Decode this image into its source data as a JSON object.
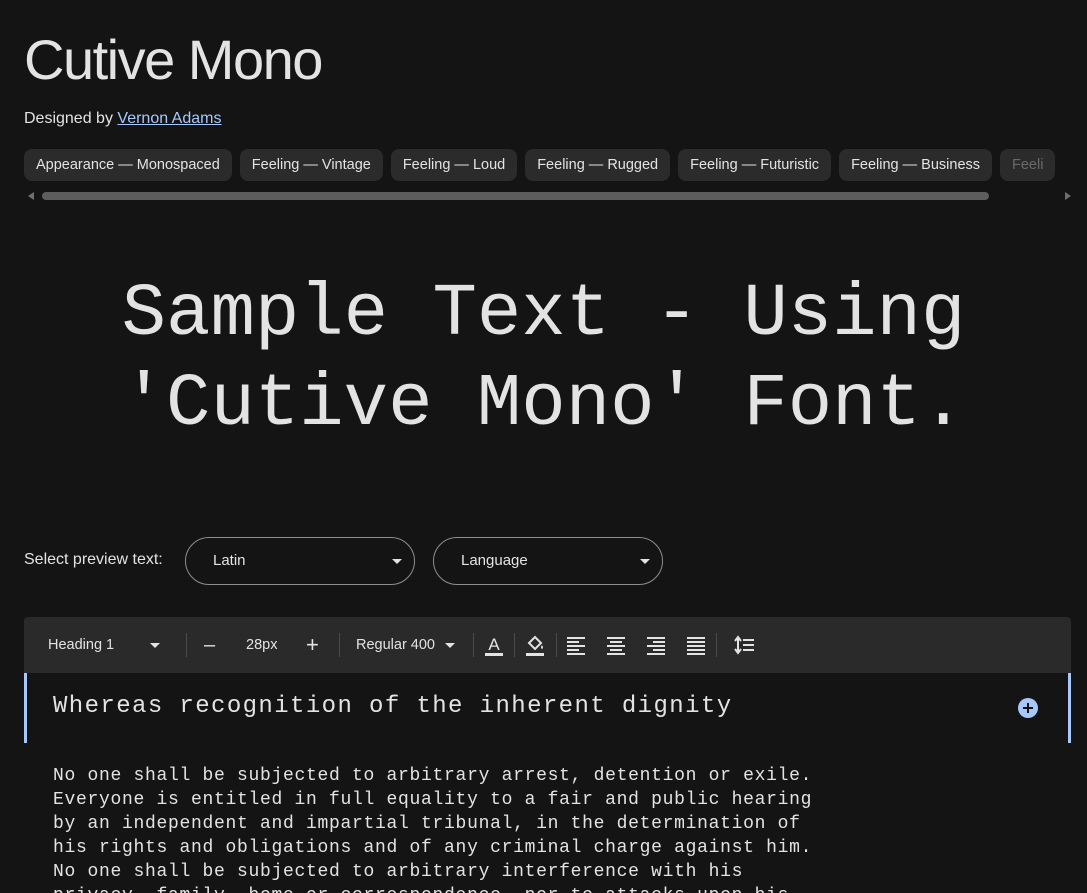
{
  "font": {
    "name": "Cutive Mono",
    "designed_by_label": "Designed by",
    "designer": "Vernon Adams"
  },
  "tags": [
    "Appearance — Monospaced",
    "Feeling — Vintage",
    "Feeling — Loud",
    "Feeling — Rugged",
    "Feeling — Futuristic",
    "Feeling — Business",
    "Feeli"
  ],
  "sample_text": "Sample Text - Using 'Cutive Mono' Font.",
  "preview": {
    "label": "Select preview text:",
    "script_select": "Latin",
    "language_select": "Language"
  },
  "toolbar": {
    "style": "Heading 1",
    "decrease": "–",
    "size": "28px",
    "increase": "+",
    "weight": "Regular 400"
  },
  "editor": {
    "heading": "Whereas recognition of the inherent dignity",
    "paragraph": "No one shall be subjected to arbitrary arrest, detention or exile.\nEveryone is entitled in full equality to a fair and public hearing\nby an independent and impartial tribunal, in the determination of\nhis rights and obligations and of any criminal charge against him.\nNo one shall be subjected to arbitrary interference with his\nprivacy, family, home or correspondence, nor to attacks upon his"
  },
  "colors": {
    "background": "#141414",
    "accent": "#a8c7fa",
    "chip": "#2b2b2b",
    "toolbar": "#2a2a2a"
  }
}
